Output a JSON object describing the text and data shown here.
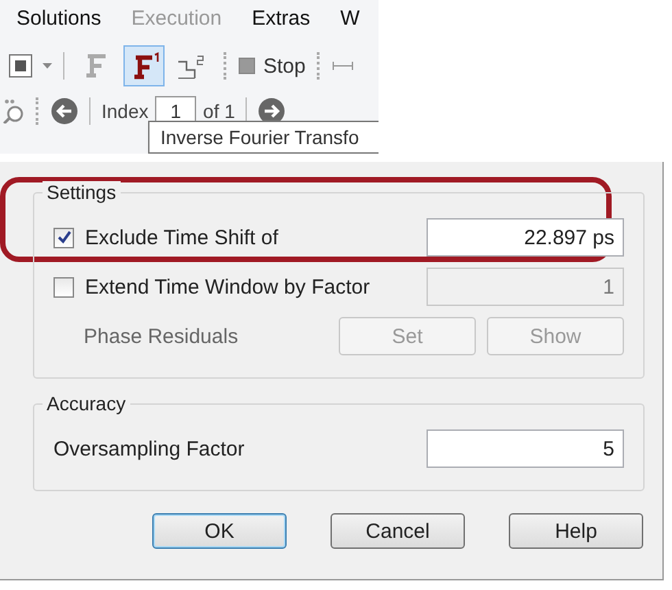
{
  "menu": [
    {
      "label": "Solutions",
      "disabled": false
    },
    {
      "label": "Execution",
      "disabled": true
    },
    {
      "label": "Extras",
      "disabled": false
    },
    {
      "label": "W",
      "disabled": false
    }
  ],
  "toolbar": {
    "tools": [
      {
        "kind": "fourier",
        "selected": false
      },
      {
        "kind": "inverse-fourier",
        "selected": true
      },
      {
        "kind": "fft-squared",
        "selected": false
      }
    ],
    "stop": "Stop",
    "index_label": "Index",
    "index_value": "1",
    "of_label": "of 1"
  },
  "tooltip": "Inverse Fourier Transfo",
  "dialog": {
    "groups": [
      {
        "title": "Settings",
        "rows": [
          {
            "kind": "checkbox-field",
            "label": "Exclude Time Shift of",
            "checked": true,
            "value": "22.897 ps",
            "disabled": false,
            "highlighted": true
          },
          {
            "kind": "checkbox-field",
            "label": "Extend Time Window by Factor",
            "checked": false,
            "value": "1",
            "disabled": true,
            "highlighted": false
          },
          {
            "kind": "buttons",
            "label": "Phase Residuals",
            "disabled": true,
            "buttons": [
              "Set",
              "Show"
            ],
            "highlighted": false
          }
        ]
      },
      {
        "title": "Accuracy",
        "rows": [
          {
            "kind": "field",
            "label": "Oversampling Factor",
            "value": "5",
            "disabled": false,
            "highlighted": false
          }
        ]
      }
    ],
    "buttons": [
      {
        "label": "OK",
        "default": true
      },
      {
        "label": "Cancel",
        "default": false
      },
      {
        "label": "Help",
        "default": false
      }
    ]
  }
}
